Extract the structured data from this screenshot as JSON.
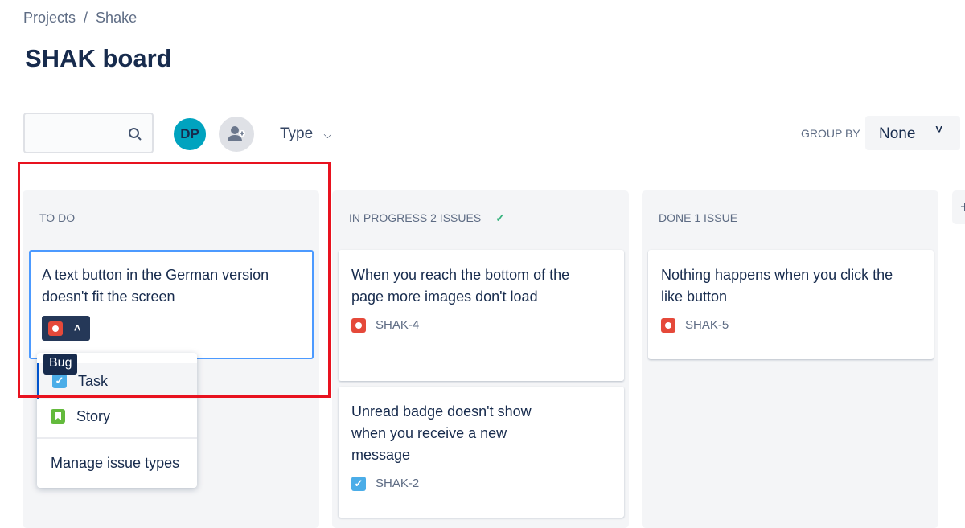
{
  "breadcrumb": {
    "items": [
      "Projects",
      "Shake"
    ],
    "separator": "/"
  },
  "page_title": "SHAK board",
  "filters": {
    "search_placeholder": "",
    "avatar_initials": "DP",
    "type_label": "Type",
    "group_by_label": "GROUP BY",
    "group_by_value": "None"
  },
  "columns": [
    {
      "title": "TO DO",
      "cards": [
        {
          "summary": "A text button in the German version doesn't fit the screen",
          "type": "bug"
        }
      ]
    },
    {
      "title": "IN PROGRESS 2 ISSUES",
      "done_check": "✓",
      "cards": [
        {
          "summary": "When you reach the bottom of the page more images don't load",
          "key": "SHAK-4",
          "type": "bug"
        },
        {
          "summary": "Unread badge doesn't show when you receive a new message",
          "key": "SHAK-2",
          "type": "task"
        }
      ]
    },
    {
      "title": "DONE 1 ISSUE",
      "cards": [
        {
          "summary": "Nothing happens when you click the like button",
          "key": "SHAK-5",
          "type": "bug"
        }
      ]
    }
  ],
  "type_menu": {
    "tooltip": "Bug",
    "items": [
      "Task",
      "Story"
    ],
    "manage": "Manage issue types"
  },
  "colors": {
    "bug": "#e5493a",
    "task": "#4bade8",
    "story": "#63ba3c",
    "highlight": "#e8121f",
    "focus": "#4c9aff"
  }
}
